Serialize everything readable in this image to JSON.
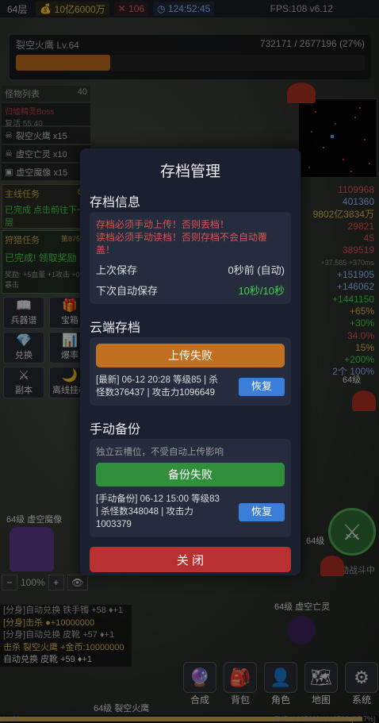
{
  "topbar": {
    "level": "64层",
    "gold": "10亿6000万",
    "stamina": "106",
    "time": "124:52:45",
    "fps": "FPS:108 v6.12"
  },
  "boss": {
    "name": "裂空火鹰 Lv.64",
    "hp": "732171 / 2677196 (27%)",
    "hp_fraction": 0.27
  },
  "monster_list": {
    "title": "怪物列表",
    "count": "40",
    "boss_name": "归墟精灵Boss",
    "boss_respawn": "复活 55:40",
    "items": [
      "裂空火鹰 x15",
      "虚空亡灵 x10",
      "虚空魔像 x15"
    ]
  },
  "quest": {
    "title": "主线任务",
    "level": "64",
    "desc": "已完成 点击前往下一层"
  },
  "hunt": {
    "title": "狩猎任务",
    "progress": "第875期",
    "desc": "已完成! 领取奖励",
    "reward": "奖励: +5血量 +1攻击 +0.5暴击"
  },
  "grid_buttons": [
    {
      "label": "兵器谱",
      "icon": "book-icon"
    },
    {
      "label": "宝箱",
      "icon": "gift-icon"
    },
    {
      "label": "兑换",
      "icon": "diamond-icon"
    },
    {
      "label": "爆率",
      "icon": "chart-icon"
    },
    {
      "label": "副本",
      "icon": "swords-icon"
    },
    {
      "label": "离线挂机",
      "icon": "moon-icon"
    }
  ],
  "stats": [
    {
      "v": "1109968",
      "c": "#e05050"
    },
    {
      "v": "401360",
      "c": "#8fb7ff"
    },
    {
      "v": "9802亿3834万",
      "c": "#d9b64a"
    },
    {
      "v": "29821",
      "c": "#e05050"
    },
    {
      "v": "45",
      "c": "#e05050"
    },
    {
      "v": "389519",
      "c": "#e05050"
    },
    {
      "v": "+37,585 +370ms",
      "c": "#888888"
    },
    {
      "v": "+151905",
      "c": "#8fb7ff"
    },
    {
      "v": "+146062",
      "c": "#8fb7ff"
    },
    {
      "v": "+1441150",
      "c": "#46d046"
    },
    {
      "v": "+65%",
      "c": "#d9b64a"
    },
    {
      "v": "+30%",
      "c": "#46d046"
    },
    {
      "v": "34.0%",
      "c": "#e05050"
    },
    {
      "v": "15%",
      "c": "#d9b64a"
    },
    {
      "v": "+200%",
      "c": "#46d046"
    },
    {
      "v": "2个 100%",
      "c": "#8fb7ff"
    }
  ],
  "world_labels": [
    "64级 虚空魔像",
    "64级 虚空亡灵",
    "64级 裂空火鹰",
    "64级",
    "64级",
    "自动战斗中"
  ],
  "zoom": {
    "minus": "−",
    "value": "100%",
    "plus": "+"
  },
  "log": [
    {
      "t": "[分身]自动兑换 铁手镯 +58 ♦+1",
      "c": "#aaaaaa"
    },
    {
      "t": "[分身]击杀 ●+10000000",
      "c": "#d9b64a"
    },
    {
      "t": "[分身]自动兑换 皮靴 +57 ♦+1",
      "c": "#aaaaaa"
    },
    {
      "t": "击杀 裂空火鹰 +金币:10000000",
      "c": "#d9b64a"
    },
    {
      "t": "自动兑换 皮靴 +59 ♦+1",
      "c": "#dddddd"
    }
  ],
  "dock": [
    {
      "label": "合成",
      "icon": "orb-icon"
    },
    {
      "label": "背包",
      "icon": "backpack-icon"
    },
    {
      "label": "角色",
      "icon": "person-icon"
    },
    {
      "label": "地图",
      "icon": "map-icon"
    },
    {
      "label": "系统",
      "icon": "gear-icon"
    }
  ],
  "exp": {
    "level": "Lv.86",
    "text": "EXP: 1065889/1113700 (95.7%)",
    "fraction": 0.957
  },
  "modal": {
    "title": "存档管理",
    "info_title": "存档信息",
    "warn1": "存档必须手动上传！否则丢档！",
    "warn2": "读档必须手动读档！否则存档不会自动覆盖！",
    "last_save_label": "上次保存",
    "last_save_value": "0秒前 (自动)",
    "next_save_label": "下次自动保存",
    "next_save_value": "10秒/10秒",
    "cloud_title": "云端存档",
    "upload_btn": "上传失败",
    "cloud_record": "[最新] 06-12 20:28 等级85 | 杀怪数376437 | 攻击力1096649",
    "restore1": "恢复",
    "manual_title": "手动备份",
    "manual_note": "独立云槽位，不受自动上传影响",
    "backup_btn": "备份失败",
    "manual_record": "[手动备份] 06-12 15:00 等级83 | 杀怪数348048 | 攻击力1003379",
    "restore2": "恢复",
    "close_btn": "关 闭"
  }
}
